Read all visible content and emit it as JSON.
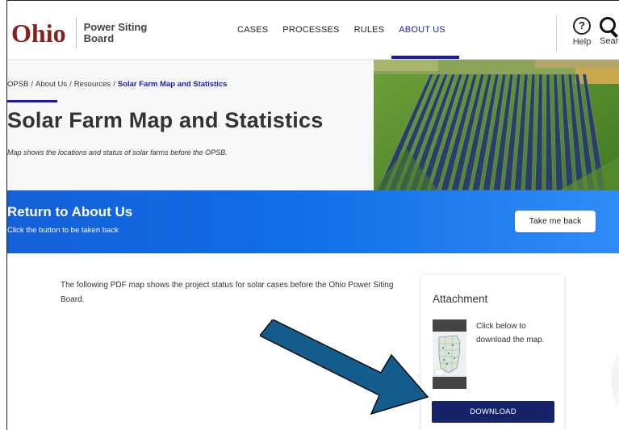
{
  "header": {
    "logo_word": "Ohio",
    "logo_line1": "Power Siting",
    "logo_line2": "Board",
    "nav": [
      {
        "label": "CASES",
        "active": false
      },
      {
        "label": "PROCESSES",
        "active": false
      },
      {
        "label": "RULES",
        "active": false
      },
      {
        "label": "ABOUT US",
        "active": true
      }
    ],
    "help_label": "Help",
    "search_label": "Search"
  },
  "hero": {
    "breadcrumb": [
      "OPSB",
      "About Us",
      "Resources",
      "Solar Farm Map and Statistics"
    ],
    "title": "Solar Farm Map and Statistics",
    "subtitle": "Map shows the locations and status of solar farms before the OPSB."
  },
  "banner": {
    "title": "Return to About Us",
    "subtitle": "Click the button to be taken back",
    "button_label": "Take me back"
  },
  "content": {
    "text": "The following PDF map shows the project status for solar cases before the Ohio Power Siting Board."
  },
  "attachment": {
    "title": "Attachment",
    "text": "Click below to download the map.",
    "button_label": "DOWNLOAD"
  },
  "colors": {
    "brand_red": "#8a1f1f",
    "accent_blue": "#1a1ab3",
    "banner_blue": "#1560d8",
    "download_navy": "#16236a",
    "arrow_blue": "#135d8d"
  },
  "icons": [
    "help-circle-icon",
    "search-icon",
    "arrow-pointer-icon"
  ]
}
